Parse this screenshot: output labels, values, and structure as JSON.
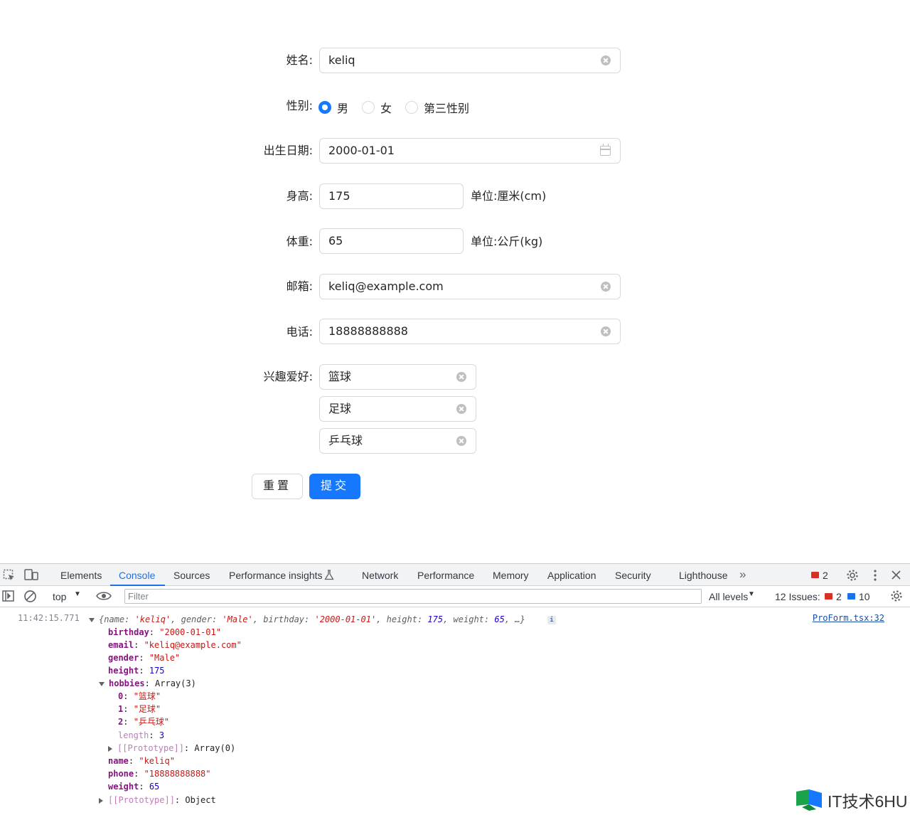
{
  "form": {
    "name": {
      "label": "姓名:",
      "value": "keliq"
    },
    "gender": {
      "label": "性别:",
      "options": [
        "男",
        "女",
        "第三性别"
      ],
      "selected": "男"
    },
    "birthday": {
      "label": "出生日期:",
      "value": "2000-01-01"
    },
    "height": {
      "label": "身高:",
      "value": "175",
      "unit": "单位:厘米(cm)"
    },
    "weight": {
      "label": "体重:",
      "value": "65",
      "unit": "单位:公斤(kg)"
    },
    "email": {
      "label": "邮箱:",
      "value": "keliq@example.com"
    },
    "phone": {
      "label": "电话:",
      "value": "18888888888"
    },
    "hobbies": {
      "label": "兴趣爱好:",
      "values": [
        "篮球",
        "足球",
        "乒乓球"
      ]
    },
    "buttons": {
      "reset": "重置",
      "submit": "提交"
    },
    "accent_color": "#1677ff"
  },
  "devtools": {
    "tabs": [
      "Elements",
      "Console",
      "Sources",
      "Performance insights",
      "Network",
      "Performance",
      "Memory",
      "Application",
      "Security",
      "Lighthouse"
    ],
    "active_tab": "Console",
    "error_count": "2",
    "context": "top",
    "filter_placeholder": "Filter",
    "levels": "All levels",
    "issues_label": "12 Issues:",
    "issues_errors": "2",
    "issues_info": "10",
    "console": {
      "timestamp": "11:42:15.771",
      "source": "ProForm.tsx:32",
      "summary": {
        "name": "'keliq'",
        "gender": "'Male'",
        "birthday": "'2000-01-01'",
        "height": "175",
        "weight": "65",
        "tail": ", …}"
      },
      "props": {
        "birthday": "\"2000-01-01\"",
        "email": "\"keliq@example.com\"",
        "gender": "\"Male\"",
        "height": "175",
        "hobbies": "Array(3)",
        "hobby0": "\"篮球\"",
        "hobby1": "\"足球\"",
        "hobby2": "\"乒乓球\"",
        "length": "3",
        "array_proto": "Array(0)",
        "name": "\"keliq\"",
        "phone": "\"18888888888\"",
        "weight": "65",
        "proto": "Object"
      }
    }
  },
  "watermark": "IT技术6HU"
}
